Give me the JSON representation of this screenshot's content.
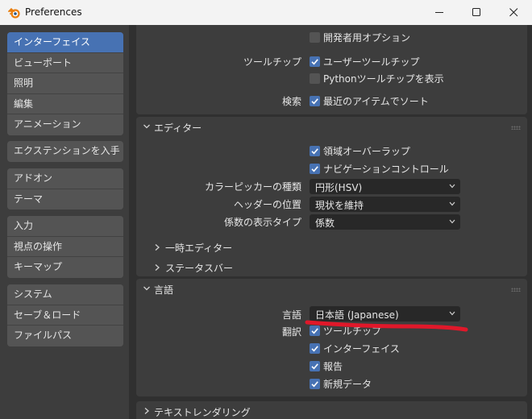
{
  "window": {
    "title": "Preferences"
  },
  "sidebar": {
    "groups": [
      [
        "インターフェイス",
        "ビューポート",
        "照明",
        "編集",
        "アニメーション"
      ],
      [
        "エクステンションを入手"
      ],
      [
        "アドオン",
        "テーマ"
      ],
      [
        "入力",
        "視点の操作",
        "キーマップ"
      ],
      [
        "システム",
        "セーブ＆ロード",
        "ファイルパス"
      ]
    ],
    "active": "インターフェイス"
  },
  "top": {
    "dev_options": "開発者用オプション",
    "tooltips_label": "ツールチップ",
    "user_tooltips": "ユーザーツールチップ",
    "python_tooltips": "Pythonツールチップを表示",
    "search_label": "検索",
    "sort_recent": "最近のアイテムでソート"
  },
  "editor": {
    "title": "エディター",
    "region_overlap": "領域オーバーラップ",
    "nav_controls": "ナビゲーションコントロール",
    "color_picker_label": "カラーピッカーの種類",
    "color_picker_value": "円形(HSV)",
    "header_pos_label": "ヘッダーの位置",
    "header_pos_value": "現状を維持",
    "factor_label": "係数の表示タイプ",
    "factor_value": "係数",
    "temp_editors": "一時エディター",
    "status_bar": "ステータスバー"
  },
  "language": {
    "title": "言語",
    "lang_label": "言語",
    "lang_value": "日本語 (Japanese)",
    "translate_label": "翻訳",
    "tooltips": "ツールチップ",
    "interface": "インターフェイス",
    "reports": "報告",
    "new_data": "新規データ"
  },
  "text_rendering": {
    "title": "テキストレンダリング"
  },
  "colors": {
    "accent": "#4772b3",
    "annotation": "#e0182a"
  }
}
